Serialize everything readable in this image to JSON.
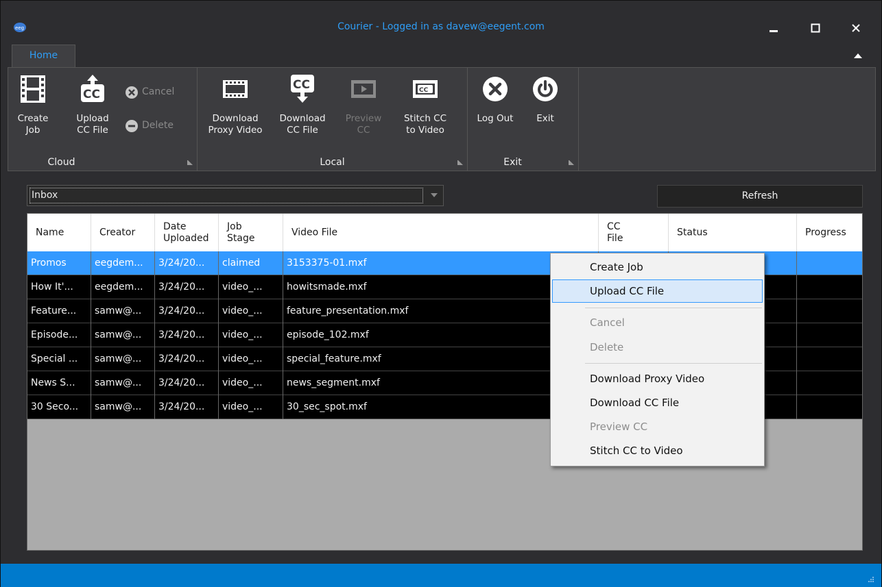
{
  "window": {
    "title": "Courier - Logged in as davew@eegent.com",
    "icon_text": "eeg",
    "controls": {
      "minimize": "minimize-icon",
      "maximize": "maximize-icon",
      "close": "close-icon"
    }
  },
  "ribbon": {
    "tabs": [
      {
        "label": "Home",
        "active": true
      }
    ],
    "groups": {
      "cloud": {
        "label": "Cloud",
        "buttons": {
          "create_job": {
            "label_line1": "Create",
            "label_line2": "Job",
            "icon": "film-icon",
            "enabled": true
          },
          "upload_cc": {
            "label_line1": "Upload",
            "label_line2": "CC File",
            "icon": "upload-cc-icon",
            "enabled": true
          },
          "cancel": {
            "label": "Cancel",
            "icon": "cancel-circle-icon",
            "enabled": false
          },
          "delete": {
            "label": "Delete",
            "icon": "delete-circle-icon",
            "enabled": false
          }
        }
      },
      "local": {
        "label": "Local",
        "buttons": {
          "download_proxy": {
            "label_line1": "Download",
            "label_line2": "Proxy Video",
            "icon": "film-strip-icon",
            "enabled": true
          },
          "download_cc": {
            "label_line1": "Download",
            "label_line2": "CC File",
            "icon": "download-cc-icon",
            "enabled": true
          },
          "preview_cc": {
            "label_line1": "Preview",
            "label_line2": "CC",
            "icon": "preview-play-icon",
            "enabled": false
          },
          "stitch_cc": {
            "label_line1": "Stitch CC",
            "label_line2": "to Video",
            "icon": "stitch-cc-icon",
            "enabled": true
          }
        }
      },
      "exit": {
        "label": "Exit",
        "buttons": {
          "log_out": {
            "label": "Log Out",
            "icon": "logout-x-icon",
            "enabled": true
          },
          "exit": {
            "label": "Exit",
            "icon": "power-icon",
            "enabled": true
          }
        }
      }
    }
  },
  "filter": {
    "selected": "Inbox"
  },
  "refresh": {
    "label": "Refresh"
  },
  "grid": {
    "columns": [
      {
        "line1": "Name",
        "line2": ""
      },
      {
        "line1": "Creator",
        "line2": ""
      },
      {
        "line1": "Date",
        "line2": "Uploaded"
      },
      {
        "line1": "Job",
        "line2": "Stage"
      },
      {
        "line1": "Video File",
        "line2": ""
      },
      {
        "line1": "CC",
        "line2": "File"
      },
      {
        "line1": "Status",
        "line2": ""
      },
      {
        "line1": "Progress",
        "line2": ""
      }
    ],
    "rows": [
      {
        "name": "Promos",
        "creator": "eegdem...",
        "date": "3/24/20...",
        "stage": "claimed",
        "video": "3153375-01.mxf",
        "cc": "",
        "status": "",
        "progress": "",
        "selected": true
      },
      {
        "name": "How It'...",
        "creator": "eegdem...",
        "date": "3/24/20...",
        "stage": "video_...",
        "video": "howitsmade.mxf",
        "cc": "",
        "status": "",
        "progress": ""
      },
      {
        "name": "Feature...",
        "creator": "samw@...",
        "date": "3/24/20...",
        "stage": "video_...",
        "video": "feature_presentation.mxf",
        "cc": "",
        "status": "",
        "progress": ""
      },
      {
        "name": "Episode...",
        "creator": "samw@...",
        "date": "3/24/20...",
        "stage": "video_...",
        "video": "episode_102.mxf",
        "cc": "",
        "status": "",
        "progress": ""
      },
      {
        "name": "Special ...",
        "creator": "samw@...",
        "date": "3/24/20...",
        "stage": "video_...",
        "video": "special_feature.mxf",
        "cc": "",
        "status": "",
        "progress": ""
      },
      {
        "name": "News S...",
        "creator": "samw@...",
        "date": "3/24/20...",
        "stage": "video_...",
        "video": "news_segment.mxf",
        "cc": "",
        "status": "",
        "progress": ""
      },
      {
        "name": "30 Seco...",
        "creator": "samw@...",
        "date": "3/24/20...",
        "stage": "video_...",
        "video": "30_sec_spot.mxf",
        "cc": "",
        "status": "",
        "progress": ""
      }
    ]
  },
  "context_menu": {
    "items": [
      {
        "label": "Create Job",
        "enabled": true
      },
      {
        "label": "Upload CC File",
        "enabled": true,
        "hover": true
      },
      {
        "label": "Cancel",
        "enabled": false
      },
      {
        "label": "Delete",
        "enabled": false
      },
      {
        "label": "Download Proxy Video",
        "enabled": true
      },
      {
        "label": "Download CC File",
        "enabled": true
      },
      {
        "label": "Preview CC",
        "enabled": false
      },
      {
        "label": "Stitch CC to Video",
        "enabled": true
      }
    ]
  },
  "colors": {
    "accent": "#2f9df5",
    "selection": "#3399ff",
    "statusbar": "#007acc",
    "window_bg": "#2d2d30"
  }
}
